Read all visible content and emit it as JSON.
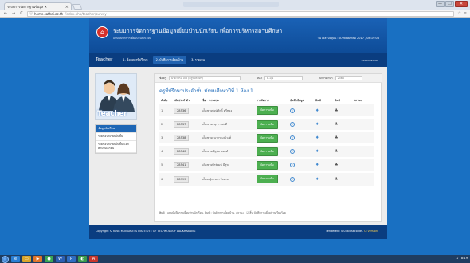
{
  "browser": {
    "tab_title": "ระบบการจัดการฐานข้อมูล ✕",
    "tab_close": "×",
    "url_host": "home.sathai.ac.th",
    "url_path": "/index.php/teacher/survey",
    "back": "←",
    "forward": "→",
    "reload": "C",
    "secure": "ⓘ",
    "icons": [
      "☆",
      "≡"
    ],
    "window_controls": [
      "—",
      "☐",
      "✕"
    ]
  },
  "site": {
    "logo_glyph": "⌂",
    "title": "ระบบการจัดการฐานข้อมูลเยี่ยมบ้านนักเรียน เพื่อการบริหารสถานศึกษา",
    "subtitle": "แบบบันทึกการเยี่ยมบ้านนักเรียน",
    "datetime": "วัน เวลาปัจจุบัน : 07 พฤษภาคม 2017 , 08:19:08"
  },
  "menu": {
    "brand": "Teacher",
    "items": [
      {
        "label": "1. ข้อมูลครูที่ปรึกษา"
      },
      {
        "label": "2. บันทึกการเยี่ยมบ้าน"
      },
      {
        "label": "3. รายงาน"
      }
    ],
    "right": "ออกจากระบบ"
  },
  "sidebar": {
    "avatar_caption": "Teacher",
    "items": [
      {
        "label": "ข้อมูลนักเรียน"
      },
      {
        "label": "รายชื่อนักเรียนในชั้น"
      },
      {
        "label": "รายชื่อนักเรียนในชั้น แยกตามห้องเรียน"
      }
    ]
  },
  "filters": {
    "teacher_label": "ชื่อครู",
    "teacher_value": "นายวัชระ ใจดี (ครูที่ปรึกษา)",
    "class_label": "ห้อง",
    "class_value": "ม.1/1",
    "year_label": "ปีการศึกษา",
    "year_value": "2560"
  },
  "class_heading": "ครูที่ปรึกษาประจำชั้น มัธยมศึกษาปีที่ 1 ห้อง 1",
  "table": {
    "headers": [
      "ลำดับ",
      "รหัสประจำตัว",
      "ชื่อ - นามสกุล",
      "การจัดการ",
      "บันทึกข้อมูล",
      "พิมพ์",
      "พิมพ์",
      "สถานะ"
    ],
    "button_label": "จัดการแฟ้ม",
    "rows": [
      {
        "no": "1",
        "id": "28536",
        "name": "เด็กชายพงษ์ศักดิ์ ศรีทอง"
      },
      {
        "no": "2",
        "id": "28537",
        "name": "เด็กชายอนุชา แสงดี"
      },
      {
        "no": "3",
        "id": "28538",
        "name": "เด็กชายธนากร มณีวงศ์"
      },
      {
        "no": "4",
        "id": "28540",
        "name": "เด็กชายณัฐพล ทองคำ"
      },
      {
        "no": "5",
        "id": "28541",
        "name": "เด็กชายพีรพัฒน์ มีสุข"
      },
      {
        "no": "6",
        "id": "28999",
        "name": "เด็กหญิงกชกร ใจงาม"
      }
    ]
  },
  "icons": {
    "info": "i",
    "drop": "♦",
    "print": "♣"
  },
  "legend": "พิมพ์ : แบบบันทึกการเยี่ยมบ้านนักเรียน, พิมพ์ : บันทึกการเยี่ยมบ้าน, สถานะ : ☑ สิ้น บันทึกการเยี่ยมบ้านเรียบร้อย",
  "footer": {
    "left": "Copyright © KING MONGKUT'S INSTITUTE OF TECHNOLOGY LADKRABANG",
    "right_prefix": "rendered : 0.0385 seconds.",
    "right_highlight": "CI Version"
  },
  "taskbar": {
    "apps": [
      "e",
      "▭",
      "▶",
      "●",
      "W",
      "P",
      "◐",
      "A"
    ],
    "time": "8:19",
    "date": "5/7/2017"
  },
  "colors": {
    "banner": "#0e4c98",
    "menubar": "#0a3d80",
    "button_green": "#4caf50",
    "accent_blue": "#1967b8"
  }
}
